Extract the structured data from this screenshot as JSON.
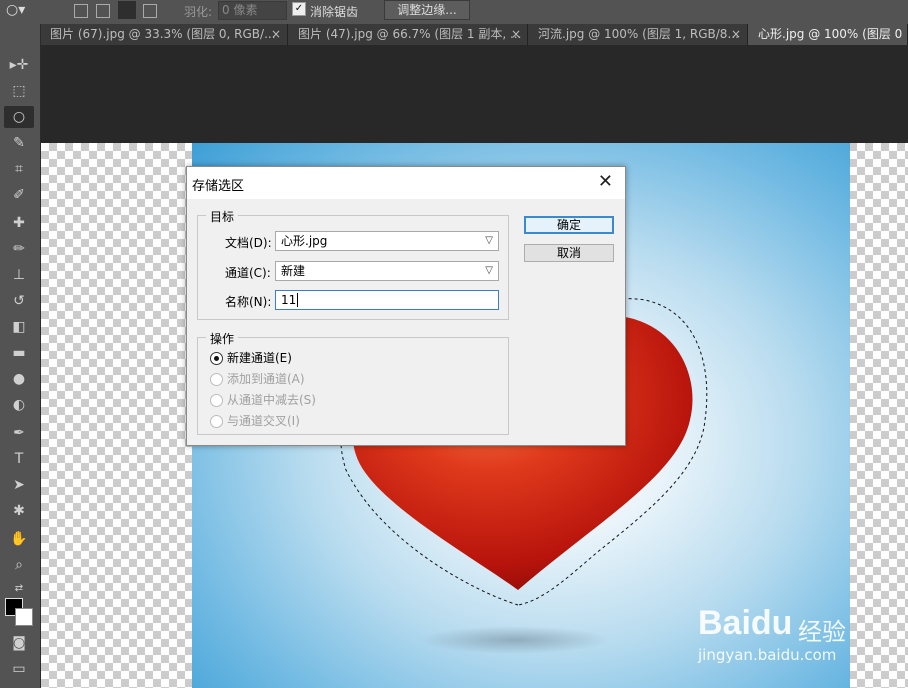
{
  "options_bar": {
    "feather_label": "羽化:",
    "feather_value": "0 像素",
    "antialias_label": "消除锯齿",
    "refine_edge_button": "调整边缘..."
  },
  "tabs": [
    {
      "label": "图片 (67).jpg @ 33.3% (图层 0, RGB/...",
      "active": false
    },
    {
      "label": "图片 (47).jpg @ 66.7% (图层 1 副本, ...",
      "active": false
    },
    {
      "label": "河流.jpg @ 100% (图层 1, RGB/8...",
      "active": false
    },
    {
      "label": "心形.jpg @ 100% (图层 0",
      "active": true
    }
  ],
  "dialog": {
    "title": "存储选区",
    "target_group": "目标",
    "document_label": "文档(D):",
    "document_value": "心形.jpg",
    "channel_label": "通道(C):",
    "channel_value": "新建",
    "name_label": "名称(N):",
    "name_value": "11",
    "operation_group": "操作",
    "operations": [
      {
        "label": "新建通道(E)",
        "checked": true,
        "enabled": true
      },
      {
        "label": "添加到通道(A)",
        "checked": false,
        "enabled": false
      },
      {
        "label": "从通道中减去(S)",
        "checked": false,
        "enabled": false
      },
      {
        "label": "与通道交叉(I)",
        "checked": false,
        "enabled": false
      }
    ],
    "ok_button": "确定",
    "cancel_button": "取消"
  },
  "watermark": {
    "brand": "Baidu",
    "sub": "经验",
    "url": "jingyan.baidu.com"
  },
  "colors": {
    "heart_red": "#d42a14",
    "annotation_arrow": "#e8353a",
    "default_button_border": "#3a8ad0"
  }
}
